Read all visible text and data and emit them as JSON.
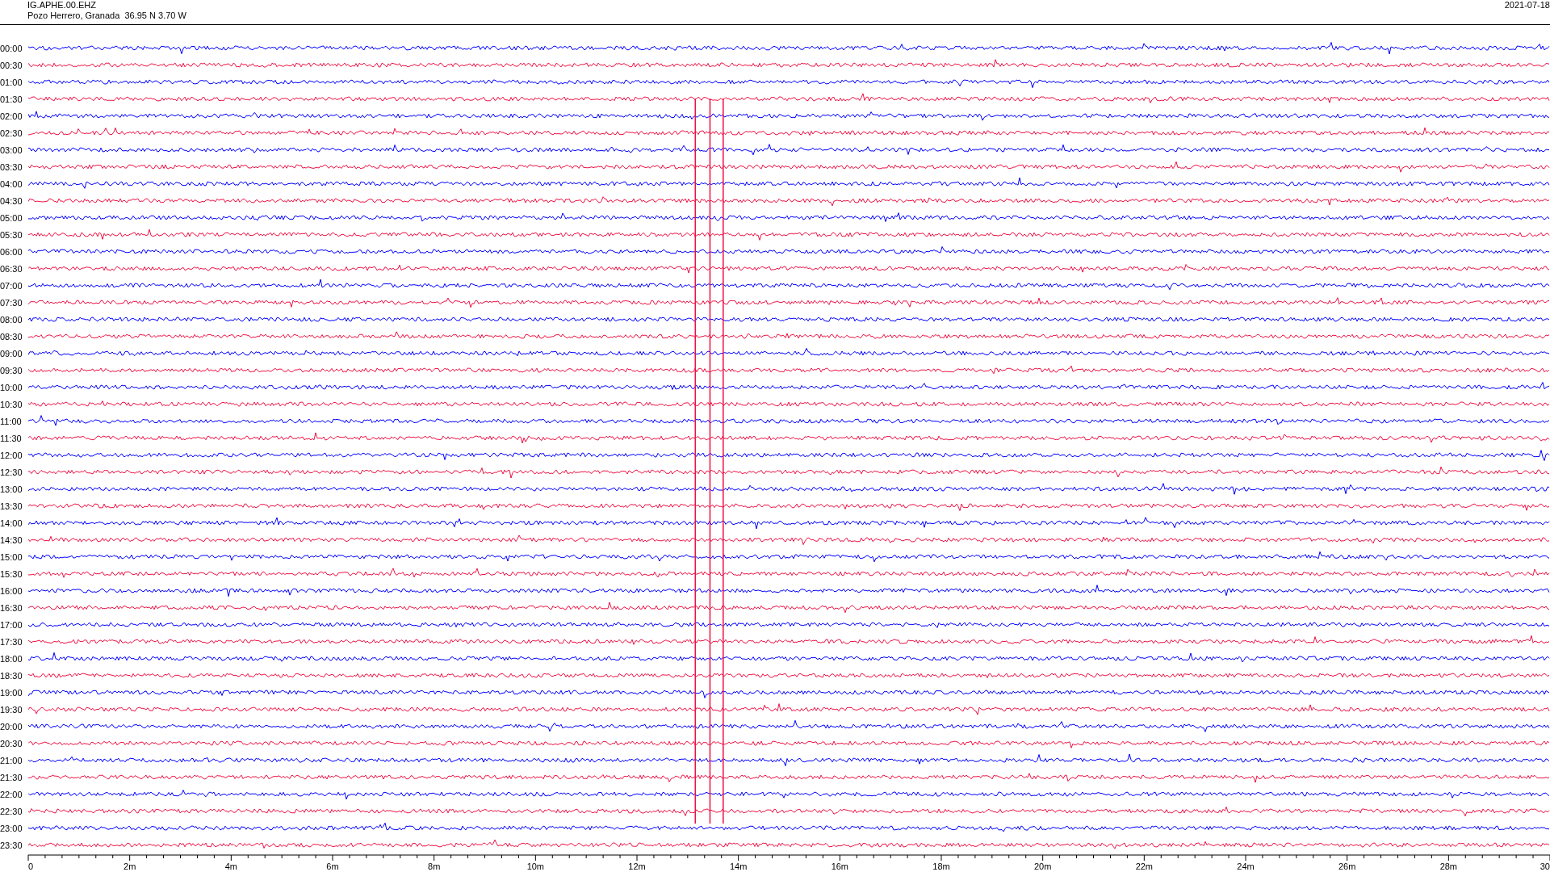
{
  "header": {
    "station": "IG.APHE.00.EHZ",
    "location": "Pozo Herrero, Granada  36.95 N 3.70 W",
    "date": "2021-07-18"
  },
  "rows": [
    {
      "time": "00:00",
      "color": "#0000ff"
    },
    {
      "time": "00:30",
      "color": "#ee1144"
    },
    {
      "time": "01:00",
      "color": "#0000ff"
    },
    {
      "time": "01:30",
      "color": "#ee1144"
    },
    {
      "time": "02:00",
      "color": "#0000ff"
    },
    {
      "time": "02:30",
      "color": "#ee1144"
    },
    {
      "time": "03:00",
      "color": "#0000ff"
    },
    {
      "time": "03:30",
      "color": "#ee1144"
    },
    {
      "time": "04:00",
      "color": "#0000ff"
    },
    {
      "time": "04:30",
      "color": "#ee1144"
    },
    {
      "time": "05:00",
      "color": "#0000ff"
    },
    {
      "time": "05:30",
      "color": "#ee1144"
    },
    {
      "time": "06:00",
      "color": "#0000ff"
    },
    {
      "time": "06:30",
      "color": "#ee1144"
    },
    {
      "time": "07:00",
      "color": "#0000ff"
    },
    {
      "time": "07:30",
      "color": "#ee1144"
    },
    {
      "time": "08:00",
      "color": "#0000ff"
    },
    {
      "time": "08:30",
      "color": "#ee1144"
    },
    {
      "time": "09:00",
      "color": "#0000ff"
    },
    {
      "time": "09:30",
      "color": "#ee1144"
    },
    {
      "time": "10:00",
      "color": "#0000ff"
    },
    {
      "time": "10:30",
      "color": "#ee1144"
    },
    {
      "time": "11:00",
      "color": "#0000ff"
    },
    {
      "time": "11:30",
      "color": "#ee1144"
    },
    {
      "time": "12:00",
      "color": "#0000ff"
    },
    {
      "time": "12:30",
      "color": "#ee1144"
    },
    {
      "time": "13:00",
      "color": "#0000ff"
    },
    {
      "time": "13:30",
      "color": "#ee1144"
    },
    {
      "time": "14:00",
      "color": "#0000ff"
    },
    {
      "time": "14:30",
      "color": "#ee1144"
    },
    {
      "time": "15:00",
      "color": "#0000ff"
    },
    {
      "time": "15:30",
      "color": "#ee1144"
    },
    {
      "time": "16:00",
      "color": "#0000ff"
    },
    {
      "time": "16:30",
      "color": "#ee1144"
    },
    {
      "time": "17:00",
      "color": "#0000ff"
    },
    {
      "time": "17:30",
      "color": "#ee1144"
    },
    {
      "time": "18:00",
      "color": "#0000ff"
    },
    {
      "time": "18:30",
      "color": "#ee1144"
    },
    {
      "time": "19:00",
      "color": "#0000ff"
    },
    {
      "time": "19:30",
      "color": "#ee1144"
    },
    {
      "time": "20:00",
      "color": "#0000ff"
    },
    {
      "time": "20:30",
      "color": "#ee1144"
    },
    {
      "time": "21:00",
      "color": "#0000ff"
    },
    {
      "time": "21:30",
      "color": "#ee1144"
    },
    {
      "time": "22:00",
      "color": "#0000ff"
    },
    {
      "time": "22:30",
      "color": "#ee1144"
    },
    {
      "time": "23:00",
      "color": "#0000ff"
    },
    {
      "time": "23:30",
      "color": "#ee1144"
    }
  ],
  "x_axis": {
    "ticks": [
      "0",
      "2m",
      "4m",
      "6m",
      "8m",
      "10m",
      "12m",
      "14m",
      "16m",
      "18m",
      "20m",
      "22m",
      "24m",
      "26m",
      "28m",
      "30"
    ]
  }
}
